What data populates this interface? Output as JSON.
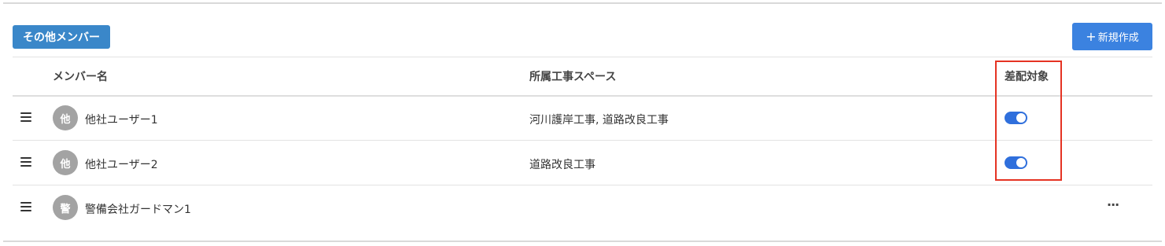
{
  "section": {
    "title": "その他メンバー"
  },
  "toolbar": {
    "new_plus": "+",
    "new_label": "新規作成"
  },
  "table": {
    "headers": {
      "name": "メンバー名",
      "workspace": "所属工事スペース",
      "target": "差配対象"
    },
    "rows": [
      {
        "avatar": "他",
        "name": "他社ユーザー1",
        "workspaces": "河川護岸工事, 道路改良工事",
        "target_on": true
      },
      {
        "avatar": "他",
        "name": "他社ユーザー2",
        "workspaces": "道路改良工事",
        "target_on": true
      },
      {
        "avatar": "警",
        "name": "警備会社ガードマン1",
        "workspaces": "",
        "more": "···"
      }
    ]
  },
  "colors": {
    "accent": "#3b82e0",
    "badge": "#3a87c9",
    "toggle": "#2f6fdc",
    "highlight": "#e53323",
    "avatar": "#a3a3a3"
  },
  "icons": {
    "drag": "drag-handle-icon",
    "more": "more-horizontal-icon"
  }
}
